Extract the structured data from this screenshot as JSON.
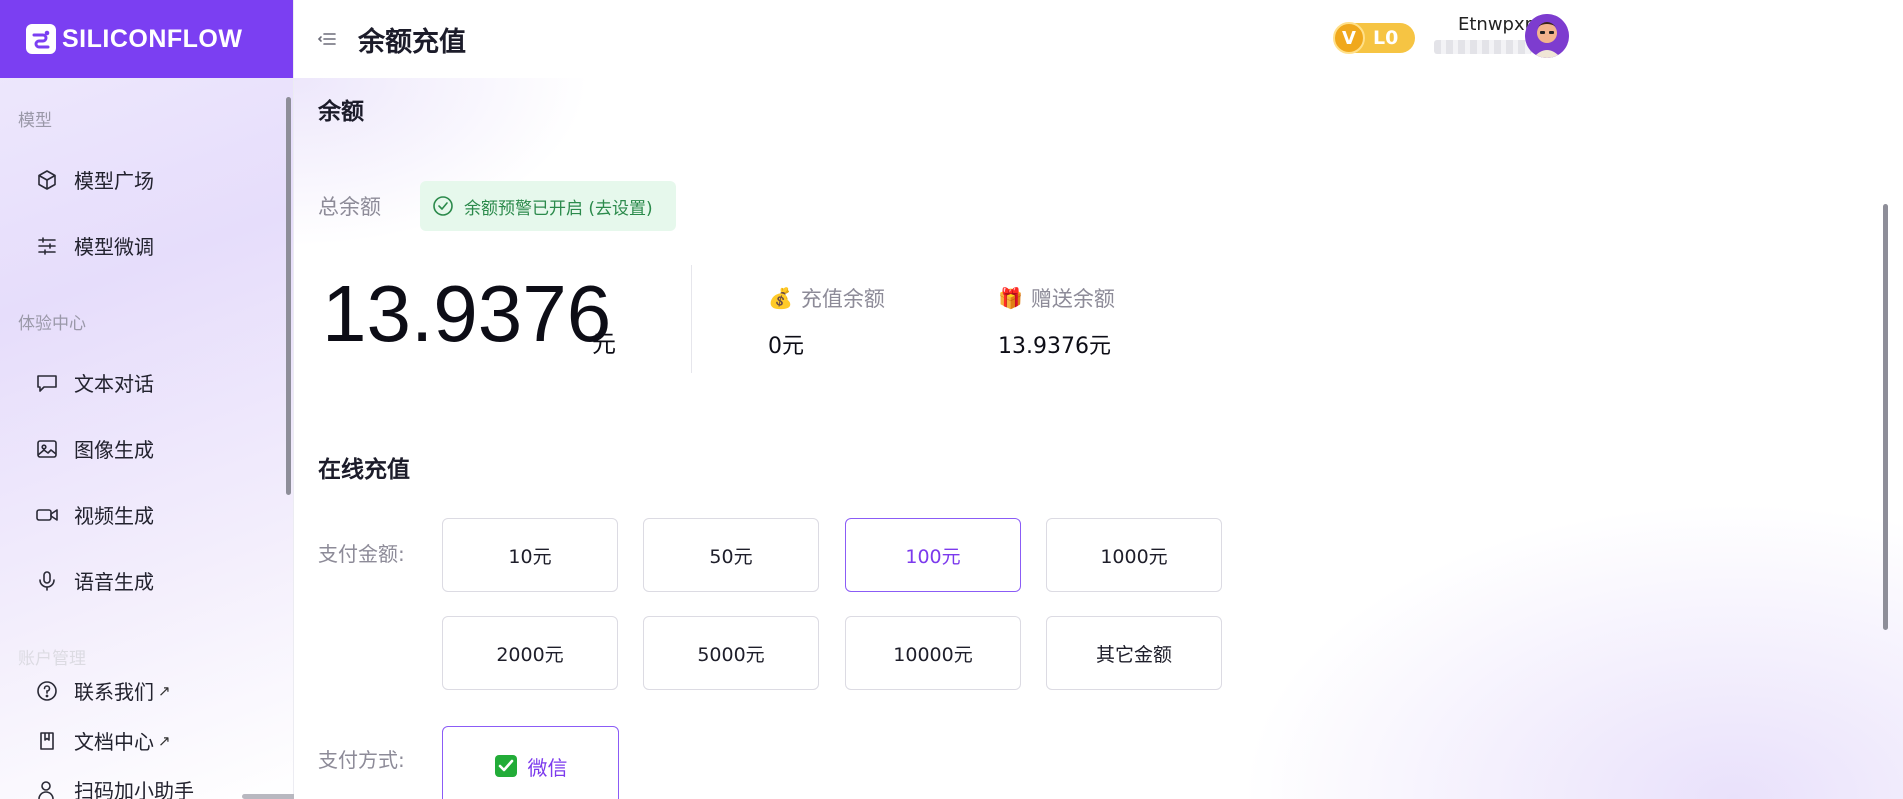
{
  "app": {
    "brand": "SILICONFLOW"
  },
  "header": {
    "title": "余额充值",
    "level": "L0",
    "level_letter": "V",
    "user_name": "Etnwpxp"
  },
  "sidebar": {
    "sections": [
      {
        "label": "模型",
        "items": [
          {
            "label": "模型广场",
            "icon": "cube-icon"
          },
          {
            "label": "模型微调",
            "icon": "sliders-icon"
          }
        ]
      },
      {
        "label": "体验中心",
        "items": [
          {
            "label": "文本对话",
            "icon": "chat-bubble-icon"
          },
          {
            "label": "图像生成",
            "icon": "image-icon"
          },
          {
            "label": "视频生成",
            "icon": "video-camera-icon"
          },
          {
            "label": "语音生成",
            "icon": "microphone-icon"
          }
        ]
      },
      {
        "label": "账户管理",
        "items": []
      }
    ],
    "links": [
      {
        "label": "联系我们",
        "ext": "↗",
        "icon": "help-circle-icon"
      },
      {
        "label": "文档中心",
        "ext": "↗",
        "icon": "book-icon"
      },
      {
        "label": "扫码加小助手",
        "icon": "user-add-icon"
      }
    ]
  },
  "balance": {
    "section_title": "余额",
    "total_label": "总余额",
    "alert_text": "余额预警已开启 (去设置)",
    "total_amount": "13.9376",
    "unit": "元",
    "recharge_label": "充值余额",
    "recharge_value": "0元",
    "gift_label": "赠送余额",
    "gift_value": "13.9376元"
  },
  "recharge": {
    "section_title": "在线充值",
    "amount_label": "支付金额:",
    "amounts": [
      "10元",
      "50元",
      "100元",
      "1000元",
      "2000元",
      "5000元",
      "10000元",
      "其它金额"
    ],
    "selected_amount": "100元",
    "method_label": "支付方式:",
    "method": "微信"
  },
  "colors": {
    "brand": "#7b3ff2",
    "accent": "#7c3aed",
    "success": "#2b8a4b",
    "badge": "#f6c443"
  }
}
